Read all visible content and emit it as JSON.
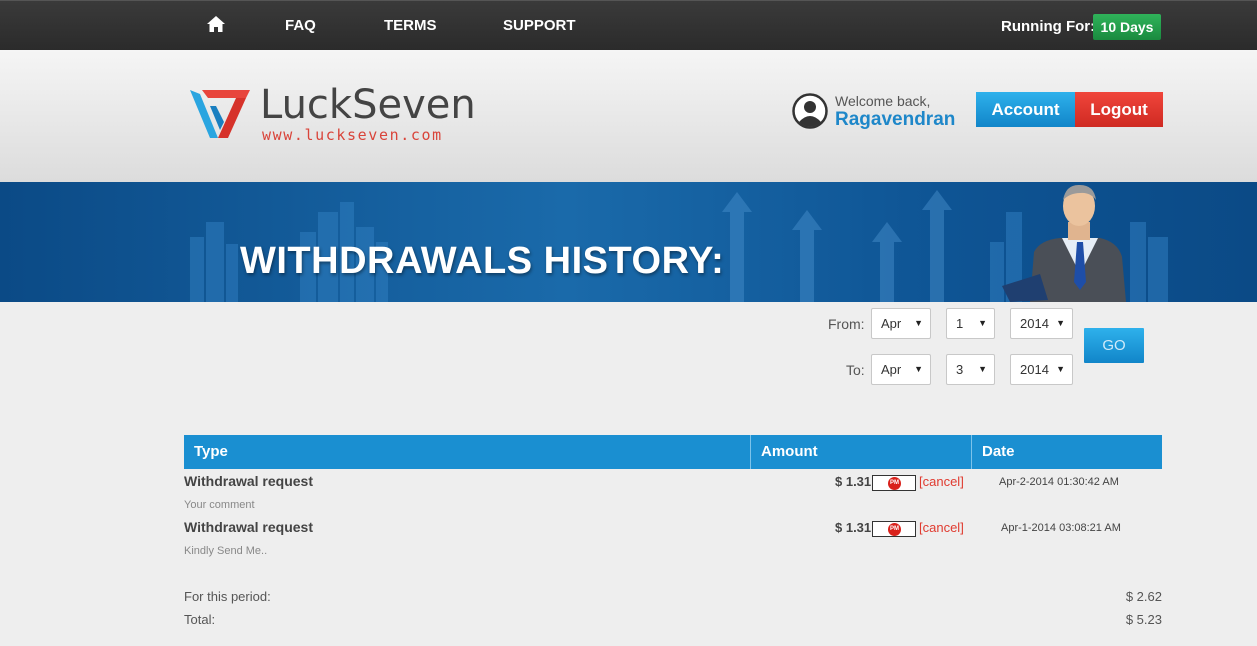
{
  "nav": {
    "home_icon": "home-icon",
    "faq": "FAQ",
    "terms": "TERMS",
    "support": "SUPPORT",
    "running_label": "Running For:",
    "running_value": "10 Days"
  },
  "header": {
    "logo_text": "LuckSeven",
    "logo_url": "www.luckseven.com",
    "welcome": "Welcome back,",
    "username": "Ragavendran",
    "account_button": "Account",
    "logout_button": "Logout"
  },
  "banner": {
    "title": "WITHDRAWALS HISTORY:"
  },
  "filter": {
    "from_label": "From:",
    "to_label": "To:",
    "from_month": "Apr",
    "from_day": "1",
    "from_year": "2014",
    "to_month": "Apr",
    "to_day": "3",
    "to_year": "2014",
    "go_button": "GO"
  },
  "table": {
    "headers": [
      "Type",
      "Amount",
      "Date"
    ],
    "rows": [
      {
        "type": "Withdrawal request",
        "comment": "Your comment",
        "amount": "$ 1.31",
        "processor": "PM",
        "action": "[cancel]",
        "date": "Apr-2-2014 01:30:42 AM"
      },
      {
        "type": "Withdrawal request",
        "comment": "Kindly Send Me..",
        "amount": "$ 1.31",
        "processor": "PM",
        "action": "[cancel]",
        "date": "Apr-1-2014 03:08:21 AM"
      }
    ]
  },
  "summary": {
    "period_label": "For this period:",
    "period_value": "$ 2.62",
    "total_label": "Total:",
    "total_value": "$ 5.23"
  },
  "colors": {
    "accent_blue": "#1a8fd1",
    "logout_red": "#e03b30",
    "badge_green": "#1a8a3f",
    "topbar": "#2b2b2b"
  }
}
